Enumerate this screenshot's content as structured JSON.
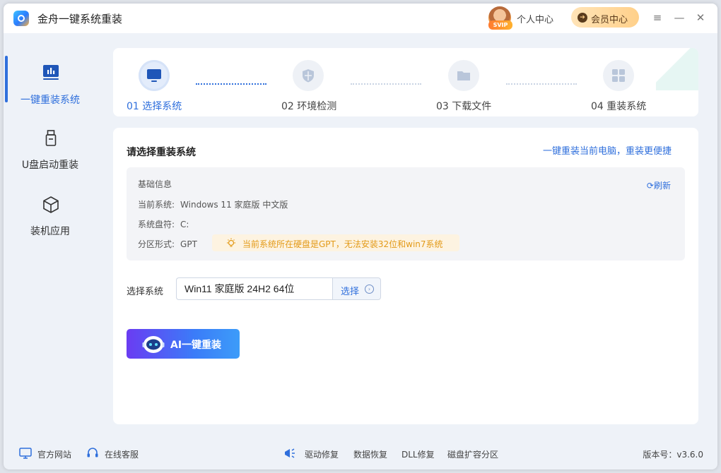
{
  "app": {
    "title": "金舟一键系统重装"
  },
  "header": {
    "svip_badge": "SVIP",
    "personal_center": "个人中心",
    "vip_center": "会员中心",
    "vip_icon": "➔",
    "minimize": "≡",
    "min": "—",
    "close": "✕"
  },
  "sidebar": {
    "items": [
      {
        "label": "一键重装系统",
        "icon": "bar-chart-icon",
        "active": true
      },
      {
        "label": "U盘启动重装",
        "icon": "usb-drive-icon",
        "active": false
      },
      {
        "label": "装机应用",
        "icon": "cube-icon",
        "active": false
      }
    ]
  },
  "steps": [
    {
      "label": "01 选择系统",
      "icon": "monitor-icon",
      "active": true
    },
    {
      "label": "02 环境检测",
      "icon": "shield-icon",
      "active": false
    },
    {
      "label": "03 下载文件",
      "icon": "folder-icon",
      "active": false
    },
    {
      "label": "04 重装系统",
      "icon": "windows-icon",
      "active": false
    }
  ],
  "main": {
    "section_title": "请选择重装系统",
    "quick_link": "一键重装当前电脑，重装更便捷",
    "info": {
      "title": "基础信息",
      "refresh": "刷新",
      "current_system_label": "当前系统:",
      "current_system_value": "Windows 11 家庭版 中文版",
      "system_drive_label": "系统盘符:",
      "system_drive_value": "C:",
      "partition_label": "分区形式:",
      "partition_value": "GPT",
      "warning": "当前系统所在硬盘是GPT，无法安装32位和win7系统"
    },
    "select_label": "选择系统",
    "system_value": "Win11 家庭版 24H2 64位",
    "select_button": "选择",
    "ai_button": "AI一键重装"
  },
  "footer": {
    "website": "官方网站",
    "support": "在线客服",
    "driver_repair": "驱动修复",
    "data_recovery": "数据恢复",
    "dll_repair": "DLL修复",
    "disk_expand": "磁盘扩容分区",
    "version": "版本号：v3.6.0"
  },
  "colors": {
    "accent": "#2f6fdc",
    "warning": "#e39a18",
    "vip_gold": "#ffd08a"
  }
}
